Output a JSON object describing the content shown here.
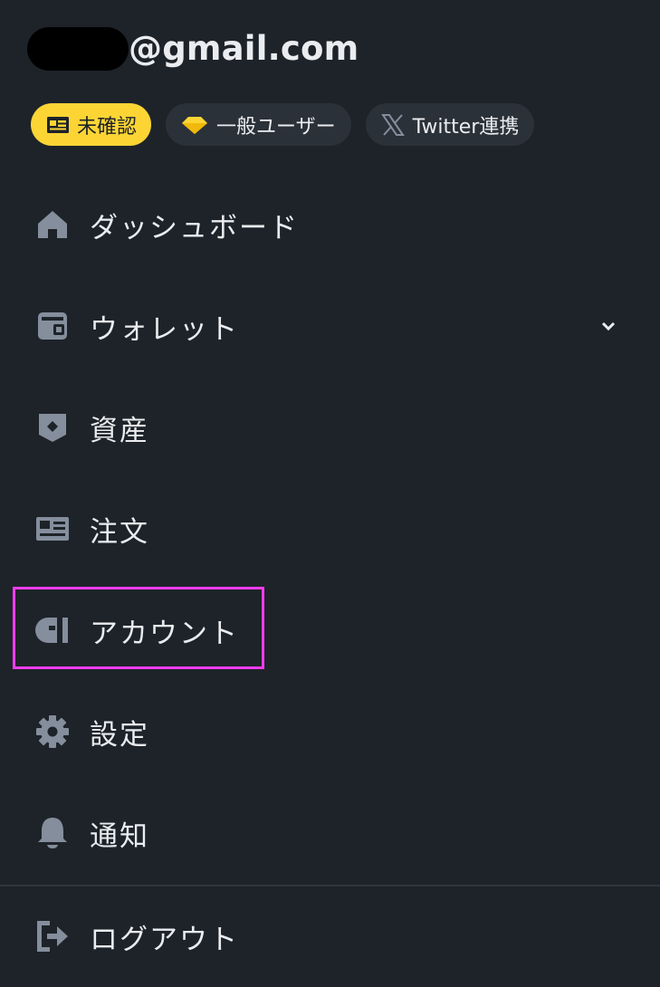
{
  "account": {
    "email_suffix": "@gmail.com"
  },
  "badges": {
    "unverified_label": "未確認",
    "user_level_label": "一般ユーザー",
    "twitter_label": "Twitter連携"
  },
  "menu": {
    "items": [
      {
        "label": "ダッシュボード",
        "icon": "home-icon"
      },
      {
        "label": "ウォレット",
        "icon": "wallet-icon",
        "has_dropdown": true
      },
      {
        "label": "資産",
        "icon": "assets-shield-icon"
      },
      {
        "label": "注文",
        "icon": "orders-card-icon"
      },
      {
        "label": "アカウント",
        "icon": "account-icon",
        "highlighted": true
      },
      {
        "label": "設定",
        "icon": "gear-icon"
      },
      {
        "label": "通知",
        "icon": "bell-icon"
      }
    ],
    "logout_label": "ログアウト"
  },
  "colors": {
    "background": "#1e2329",
    "text": "#eaecef",
    "icon": "#848e9c",
    "accent_yellow": "#fcd535",
    "badge_bg": "#2b3139",
    "highlight": "#ef3cee"
  }
}
